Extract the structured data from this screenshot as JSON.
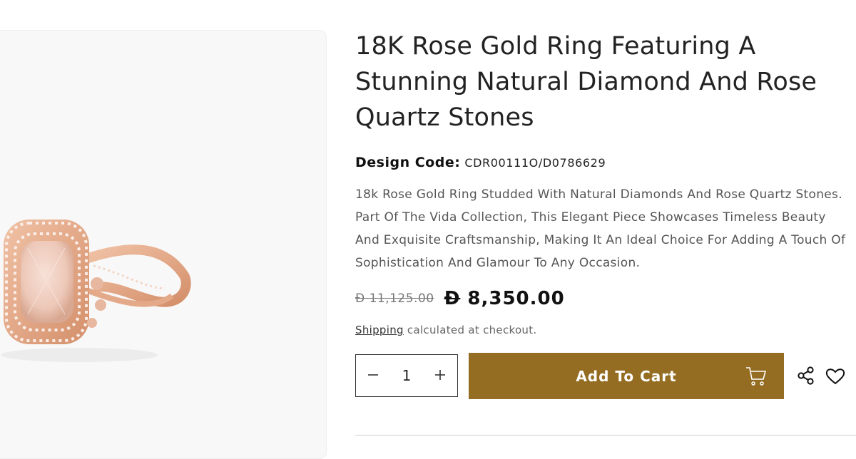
{
  "product": {
    "title": "18K Rose Gold Ring Featuring A Stunning Natural Diamond And Rose Quartz Stones",
    "design_code_label": "Design Code:",
    "design_code_value": "CDR00111O/D0786629",
    "description": "18k Rose Gold Ring Studded With Natural Diamonds And Rose Quartz Stones. Part Of The Vida Collection, This Elegant Piece Showcases Timeless Beauty And Exquisite Craftsmanship, Making It An Ideal Choice For Adding A Touch Of Sophistication And Glamour To Any Occasion.",
    "old_price": "Ð 11,125.00",
    "currency_symbol": "Ð",
    "new_price": "8,350.00",
    "shipping_link": "Shipping",
    "shipping_text": " calculated at checkout.",
    "quantity": "1",
    "decrease_icon": "minus-icon",
    "increase_icon": "plus-icon",
    "add_to_cart_label": "Add To Cart",
    "cart_icon": "cart-icon",
    "share_icon": "share-icon",
    "wishlist_icon": "heart-icon"
  },
  "colors": {
    "accent": "#946d22",
    "rose_gold": "#e2a98a",
    "quartz": "#f1cfc2"
  }
}
